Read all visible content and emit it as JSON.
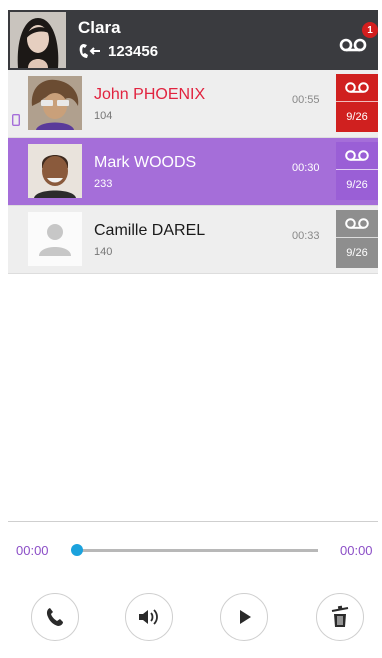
{
  "header": {
    "user_name": "Clara",
    "extension": "123456",
    "voicemail_badge": "1"
  },
  "voicemails": [
    {
      "name": "John PHOENIX",
      "ext": "104",
      "duration": "00:55",
      "date": "9/26",
      "state": "missed",
      "tile_color": "#d0201f",
      "mobile": true
    },
    {
      "name": "Mark WOODS",
      "ext": "233",
      "duration": "00:30",
      "date": "9/26",
      "state": "selected",
      "tile_color": "#9a5fd6",
      "mobile": false
    },
    {
      "name": "Camille DAREL",
      "ext": "140",
      "duration": "00:33",
      "date": "9/26",
      "state": "read",
      "tile_color": "#8e8e8e",
      "mobile": false
    }
  ],
  "player": {
    "elapsed": "00:00",
    "total": "00:00",
    "progress": 0
  },
  "controls": [
    "phone-icon",
    "speaker-icon",
    "play-icon",
    "trash-icon"
  ],
  "colors": {
    "header_bg": "#3a3b3f",
    "accent_purple": "#a56ed9",
    "missed_red": "#e1233f",
    "slider_blue": "#1ba2dd"
  }
}
